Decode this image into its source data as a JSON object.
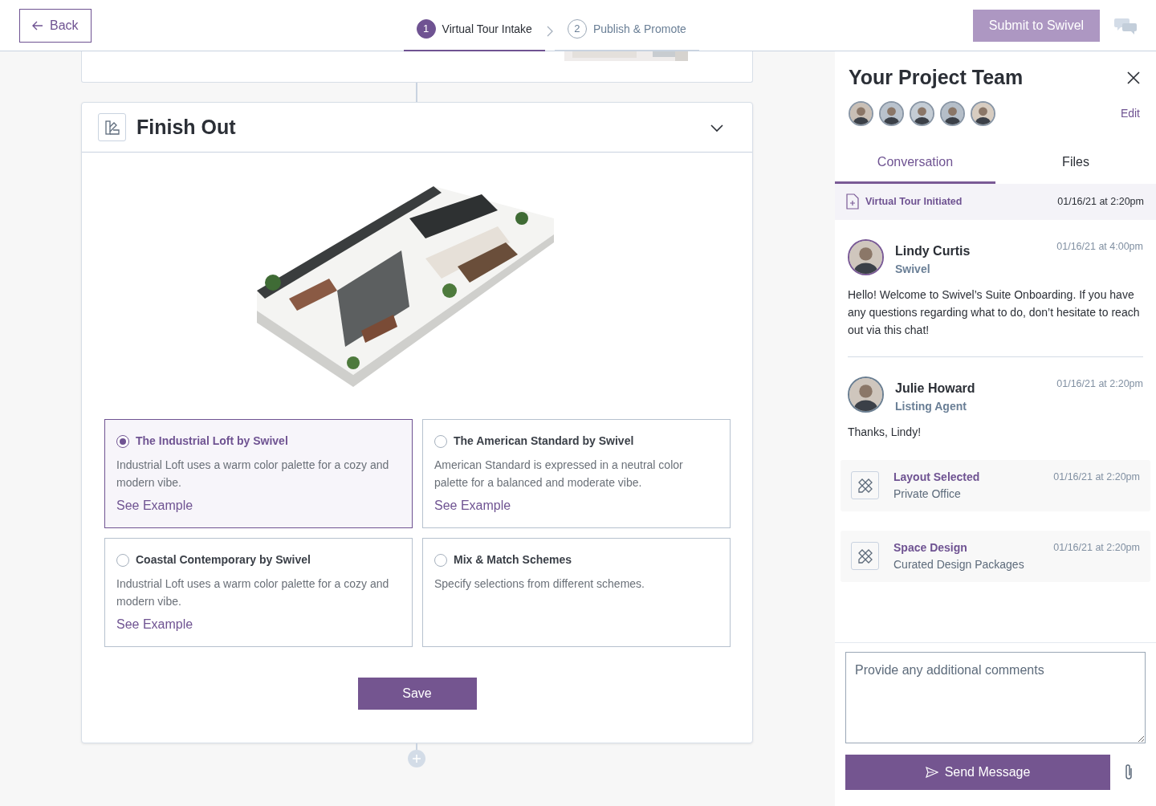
{
  "header": {
    "back": "Back",
    "steps": [
      {
        "number": "1",
        "label": "Virtual Tour Intake",
        "selected": true
      },
      {
        "number": "2",
        "label": "Publish & Promote",
        "selected": false
      }
    ],
    "submit": {
      "label": "Submit to Swivel",
      "disabled": true
    }
  },
  "main": {
    "section": {
      "title": "Finish Out",
      "expanded": true,
      "options": [
        {
          "title": "The Industrial Loft by Swivel",
          "description": "Industrial Loft uses a warm color palette for a cozy and modern vibe.",
          "link": "See Example",
          "selected": true
        },
        {
          "title": "The American Standard by Swivel",
          "description": "American Standard is expressed in a neutral color palette for a balanced and moderate vibe.",
          "link": "See Example",
          "selected": false
        },
        {
          "title": "Coastal Contemporary by Swivel",
          "description": "Industrial Loft uses a warm color palette for a cozy and modern vibe.",
          "link": "See Example",
          "selected": false
        },
        {
          "title": "Mix & Match Schemes",
          "description": "Specify selections from different schemes.",
          "selected": false
        }
      ],
      "save": "Save"
    }
  },
  "panel": {
    "title": "Your Project Team",
    "edit": "Edit",
    "tabs": [
      {
        "label": "Conversation",
        "selected": true
      },
      {
        "label": "Files",
        "selected": false
      }
    ],
    "feed": [
      {
        "kind": "event",
        "title": "Virtual Tour Initiated",
        "time": "01/16/21 at 2:20pm"
      },
      {
        "kind": "message",
        "name": "Lindy Curtis",
        "role": "Swivel",
        "time": "01/16/21 at 4:00pm",
        "text": "Hello! Welcome to Swivel’s Suite Onboarding. If you have any questions regarding what to do, don’t hesitate to reach out via this chat!",
        "color": "#7a5a96"
      },
      {
        "kind": "message",
        "name": "Julie Howard",
        "role": "Listing Agent",
        "time": "01/16/21 at 2:20pm",
        "text": "Thanks, Lindy!",
        "color": "#6b7f92"
      },
      {
        "kind": "activity",
        "title": "Layout Selected",
        "subtitle": "Private Office",
        "time": "01/16/21 at 2:20pm"
      },
      {
        "kind": "activity",
        "title": "Space Design",
        "subtitle": "Curated Design Packages",
        "time": "01/16/21 at 2:20pm"
      }
    ],
    "comment_placeholder": "Provide any additional comments",
    "send": "Send Message"
  }
}
